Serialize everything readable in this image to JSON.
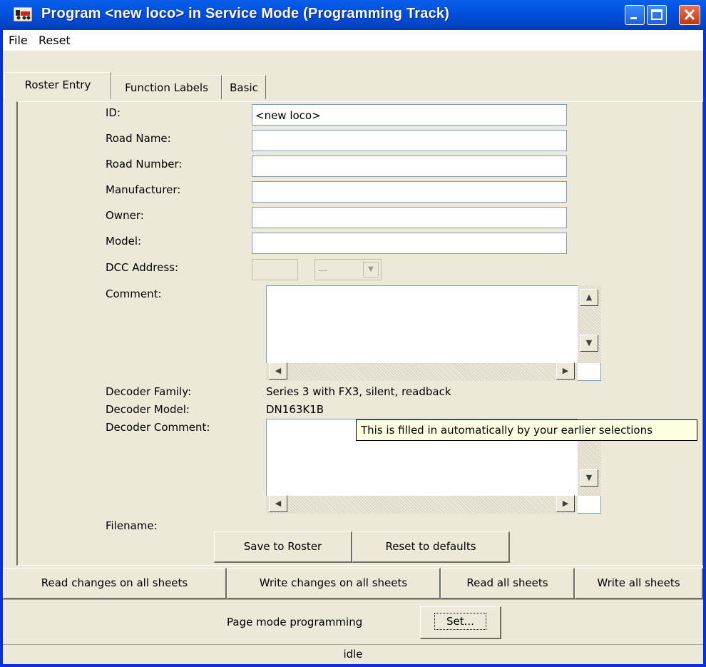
{
  "window": {
    "title": "Program <new loco> in Service Mode (Programming Track)",
    "accent": "#0054e3",
    "close_color": "#c2350f"
  },
  "menu": {
    "items": [
      "File",
      "Reset"
    ]
  },
  "tabs": [
    {
      "label": "Roster Entry",
      "active": true
    },
    {
      "label": "Function Labels",
      "active": false
    },
    {
      "label": "Basic",
      "active": false
    }
  ],
  "roster": {
    "id_label": "ID:",
    "id_value": "<new loco>",
    "road_name_label": "Road Name:",
    "road_name_value": "",
    "road_number_label": "Road Number:",
    "road_number_value": "",
    "manufacturer_label": "Manufacturer:",
    "manufacturer_value": "",
    "owner_label": "Owner:",
    "owner_value": "",
    "model_label": "Model:",
    "model_value": "",
    "dcc_address_label": "DCC Address:",
    "dcc_address_value": "",
    "dcc_address_type": "---",
    "comment_label": "Comment:",
    "comment_value": "",
    "decoder_family_label": "Decoder Family:",
    "decoder_family_value": "Series 3 with FX3, silent, readback",
    "decoder_model_label": "Decoder Model:",
    "decoder_model_value": "DN163K1B",
    "decoder_comment_label": "Decoder Comment:",
    "decoder_comment_value": "",
    "filename_label": "Filename:",
    "filename_value": "",
    "save_button": "Save to Roster",
    "reset_button": "Reset to defaults"
  },
  "tooltip": "This is filled in automatically by your earlier selections",
  "sheet_buttons": [
    "Read changes on all sheets",
    "Write changes on all sheets",
    "Read all sheets",
    "Write all sheets"
  ],
  "programming": {
    "mode_label": "Page mode programming",
    "set_button": "Set..."
  },
  "status": "idle",
  "icons": {
    "app": "train-icon",
    "minimize": "minimize-icon",
    "maximize": "maximize-icon",
    "close": "close-icon"
  }
}
